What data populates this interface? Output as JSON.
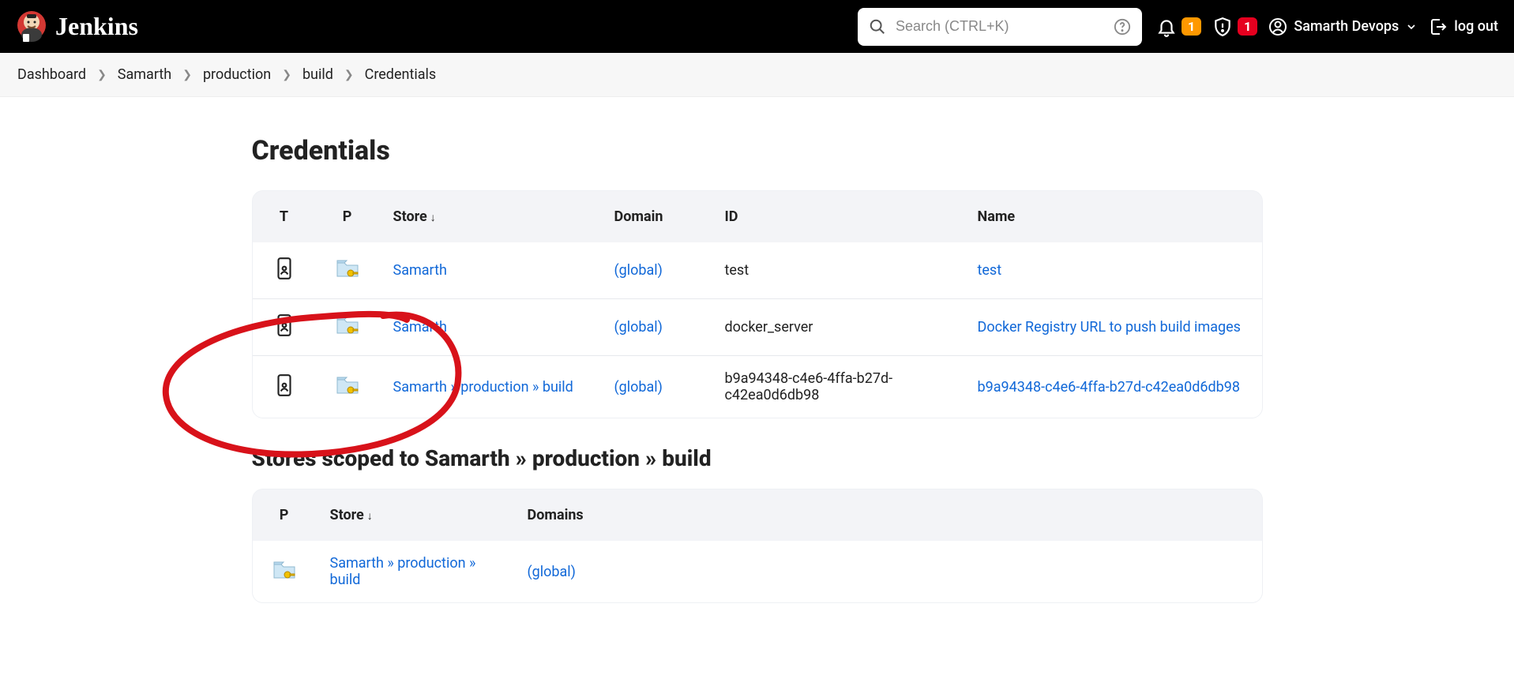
{
  "header": {
    "app_name": "Jenkins",
    "search_placeholder": "Search (CTRL+K)",
    "notif_badge": "1",
    "alert_badge": "1",
    "user_name": "Samarth Devops",
    "logout_label": "log out"
  },
  "breadcrumbs": [
    "Dashboard",
    "Samarth",
    "production",
    "build",
    "Credentials"
  ],
  "page": {
    "title": "Credentials",
    "stores_title": "Stores scoped to Samarth » production » build"
  },
  "cred_table": {
    "headers": {
      "t": "T",
      "p": "P",
      "store": "Store",
      "domain": "Domain",
      "id": "ID",
      "name": "Name"
    },
    "rows": [
      {
        "store": "Samarth",
        "domain": "(global)",
        "id": "test",
        "name": "test"
      },
      {
        "store": "Samarth",
        "domain": "(global)",
        "id": "docker_server",
        "name": "Docker Registry URL to push build images"
      },
      {
        "store": "Samarth » production » build",
        "domain": "(global)",
        "id": "b9a94348-c4e6-4ffa-b27d-c42ea0d6db98",
        "name": "b9a94348-c4e6-4ffa-b27d-c42ea0d6db98"
      }
    ]
  },
  "stores_table": {
    "headers": {
      "p": "P",
      "store": "Store",
      "domains": "Domains"
    },
    "rows": [
      {
        "store": "Samarth » production » build",
        "domains": "(global)"
      }
    ]
  },
  "icons": {
    "t_icon": "credential-phone-icon",
    "p_icon": "folder-key-icon"
  }
}
